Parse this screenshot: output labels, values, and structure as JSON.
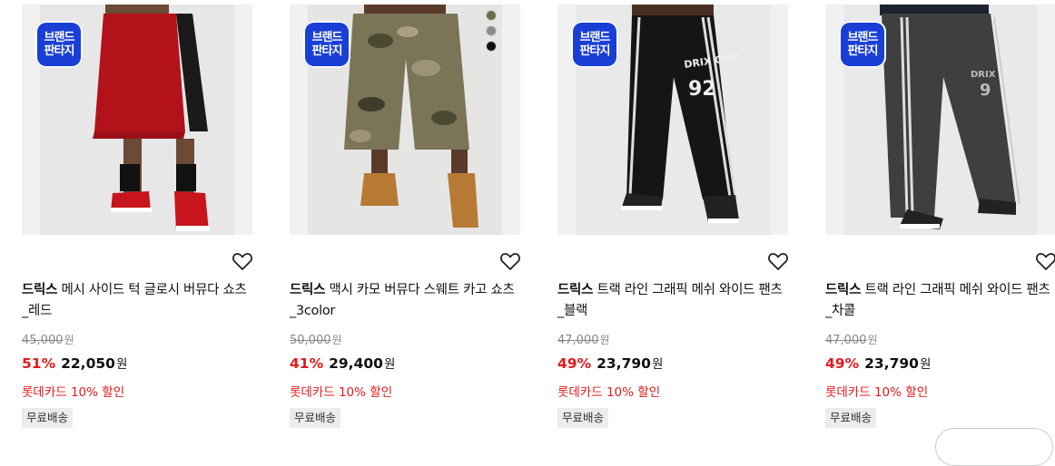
{
  "badge": {
    "line1": "브랜드",
    "line2": "판타지"
  },
  "products": [
    {
      "brand": "드릭스",
      "name": "메시 사이드 턱 글로시 버뮤다 쇼츠_레드",
      "original_price": "45,000",
      "original_unit": "원",
      "discount": "51%",
      "sale_price": "22,050",
      "sale_unit": "원",
      "promo": "롯데카드 10% 할인",
      "shipping": "무료배송",
      "colors": {
        "main": "#b3121b",
        "side": "#1a1a1a",
        "shoe": "#111111"
      }
    },
    {
      "brand": "드릭스",
      "name": "맥시 카모 버뮤다 스웨트 카고 쇼츠_3color",
      "original_price": "50,000",
      "original_unit": "원",
      "discount": "41%",
      "sale_price": "29,400",
      "sale_unit": "원",
      "promo": "롯데카드 10% 할인",
      "shipping": "무료배송",
      "swatches": [
        "#6b6f4a",
        "#8a8a86",
        "#111111"
      ],
      "colors": {
        "main": "#7b7457",
        "side": "#4a4a33",
        "shoe": "#b77a35"
      }
    },
    {
      "brand": "드릭스",
      "name": "트랙 라인 그래픽 메쉬 와이드 팬츠_블랙",
      "original_price": "47,000",
      "original_unit": "원",
      "discount": "49%",
      "sale_price": "23,790",
      "sale_unit": "원",
      "promo": "롯데카드 10% 할인",
      "shipping": "무료배송",
      "colors": {
        "main": "#151515",
        "side": "#151515",
        "shoe": "#222222"
      }
    },
    {
      "brand": "드릭스",
      "name": "트랙 라인 그래픽 메쉬 와이드 팬츠_차콜",
      "original_price": "47,000",
      "original_unit": "원",
      "discount": "49%",
      "sale_price": "23,790",
      "sale_unit": "원",
      "promo": "롯데카드 10% 할인",
      "shipping": "무료배송",
      "colors": {
        "main": "#3d403f",
        "side": "#3d403f",
        "shoe": "#222222"
      }
    }
  ],
  "icons": {
    "wishlist": "heart-outline-icon"
  }
}
